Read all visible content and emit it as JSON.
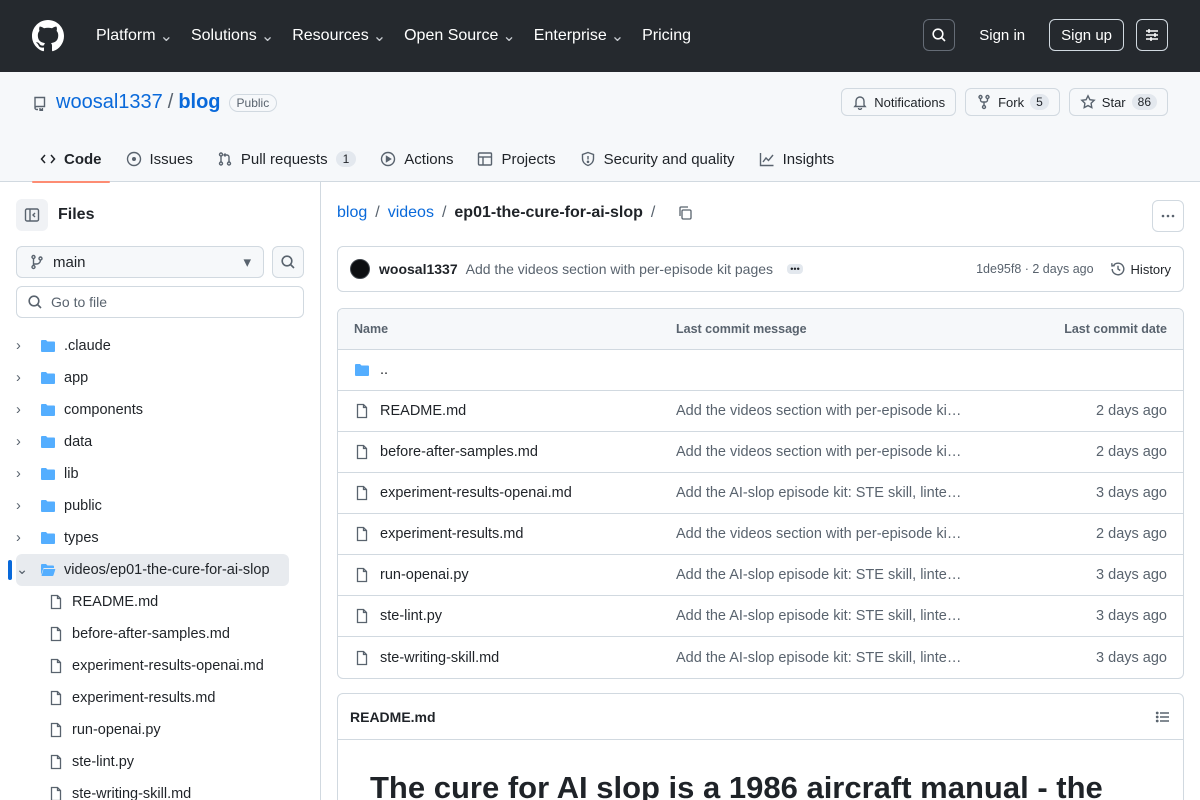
{
  "header": {
    "nav": [
      {
        "label": "Platform",
        "has_chevron": true
      },
      {
        "label": "Solutions",
        "has_chevron": true
      },
      {
        "label": "Resources",
        "has_chevron": true
      },
      {
        "label": "Open Source",
        "has_chevron": true
      },
      {
        "label": "Enterprise",
        "has_chevron": true
      },
      {
        "label": "Pricing",
        "has_chevron": false
      }
    ],
    "sign_in": "Sign in",
    "sign_up": "Sign up"
  },
  "repo": {
    "owner": "woosal1337",
    "separator": "/",
    "name": "blog",
    "visibility": "Public",
    "notifications_label": "Notifications",
    "fork_label": "Fork",
    "fork_count": "5",
    "star_label": "Star",
    "star_count": "86"
  },
  "tabs": [
    {
      "label": "Code",
      "icon": "code-icon",
      "active": true
    },
    {
      "label": "Issues",
      "icon": "issue-icon"
    },
    {
      "label": "Pull requests",
      "icon": "pull-request-icon",
      "count": "1"
    },
    {
      "label": "Actions",
      "icon": "play-icon"
    },
    {
      "label": "Projects",
      "icon": "table-icon"
    },
    {
      "label": "Security and quality",
      "icon": "shield-icon"
    },
    {
      "label": "Insights",
      "icon": "graph-icon"
    }
  ],
  "sidebar": {
    "title": "Files",
    "branch": "main",
    "goto_placeholder": "Go to file",
    "folders": [
      ".claude",
      "app",
      "components",
      "data",
      "lib",
      "public",
      "types"
    ],
    "open_folder": "videos/ep01-the-cure-for-ai-slop",
    "files": [
      "README.md",
      "before-after-samples.md",
      "experiment-results-openai.md",
      "experiment-results.md",
      "run-openai.py",
      "ste-lint.py",
      "ste-writing-skill.md"
    ]
  },
  "breadcrumb": {
    "root": "blog",
    "sep": "/",
    "folder": "videos",
    "current": "ep01-the-cure-for-ai-slop",
    "trailing": "/"
  },
  "commit": {
    "author": "woosal1337",
    "message": "Add the videos section with per-episode kit pages",
    "meta": "1de95f8 · 2 days ago",
    "history_label": "History"
  },
  "table": {
    "headers": {
      "name": "Name",
      "message": "Last commit message",
      "date": "Last commit date"
    },
    "parent": "..",
    "rows": [
      {
        "name": "README.md",
        "message": "Add the videos section with per-episode kit pages",
        "date": "2 days ago"
      },
      {
        "name": "before-after-samples.md",
        "message": "Add the videos section with per-episode kit pages",
        "date": "2 days ago"
      },
      {
        "name": "experiment-results-openai.md",
        "message": "Add the AI-slop episode kit: STE skill, linter, and test harness",
        "date": "3 days ago"
      },
      {
        "name": "experiment-results.md",
        "message": "Add the videos section with per-episode kit pages",
        "date": "2 days ago"
      },
      {
        "name": "run-openai.py",
        "message": "Add the AI-slop episode kit: STE skill, linter, and test harness",
        "date": "3 days ago"
      },
      {
        "name": "ste-lint.py",
        "message": "Add the AI-slop episode kit: STE skill, linter, and test harness",
        "date": "3 days ago"
      },
      {
        "name": "ste-writing-skill.md",
        "message": "Add the AI-slop episode kit: STE skill, linter, and test harness",
        "date": "3 days ago"
      }
    ]
  },
  "readme": {
    "filename": "README.md",
    "heading": "The cure for AI slop is a 1986 aircraft manual - the"
  },
  "colors": {
    "accent": "#0969da",
    "header_bg": "#25292e",
    "folder": "#54aeff",
    "tab_underline": "#fd8c73"
  }
}
